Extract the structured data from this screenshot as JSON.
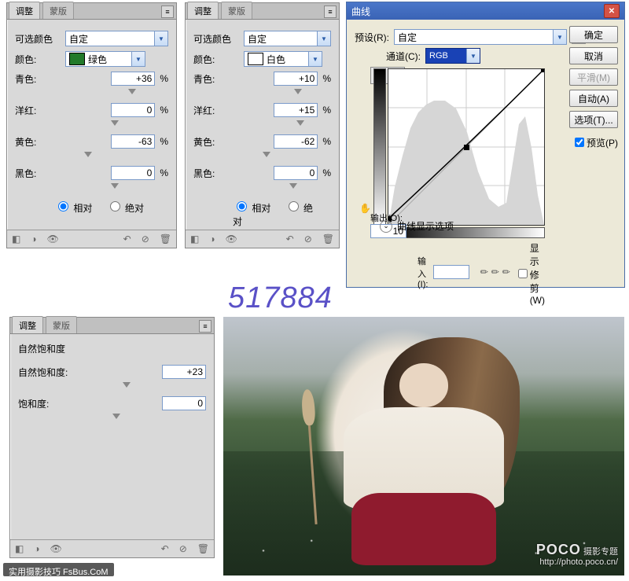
{
  "tabs": {
    "adjust": "调整",
    "mask": "蒙版"
  },
  "selcolor": {
    "title": "可选颜色",
    "custom": "自定",
    "green": {
      "swatch": "#227a2a",
      "label": "绿色"
    },
    "white": {
      "swatch": "#ffffff",
      "label": "白色"
    },
    "colorLabel": "颜色:",
    "cyan": "青色:",
    "magenta": "洋红:",
    "yellow": "黄色:",
    "black": "黑色:",
    "p1": {
      "c": "+36",
      "m": "0",
      "y": "-63",
      "k": "0"
    },
    "p2": {
      "c": "+10",
      "m": "+15",
      "y": "-62",
      "k": "0"
    },
    "relative": "相对",
    "absolute": "绝对",
    "pct": "%"
  },
  "curves": {
    "title": "曲线",
    "presetLabel": "预设(R):",
    "preset": "自定",
    "channelLabel": "通道(C):",
    "channel": "RGB",
    "outputLabel": "输出(O):",
    "output": "10",
    "inputLabel": "输入(I):",
    "showClip": "显示修剪(W)",
    "disp": "曲线显示选项",
    "buttons": {
      "ok": "确定",
      "cancel": "取消",
      "smooth": "平滑(M)",
      "auto": "自动(A)",
      "options": "选项(T)...",
      "preview": "预览(P)"
    }
  },
  "vibrance": {
    "title": "自然饱和度",
    "vibLabel": "自然饱和度:",
    "vib": "+23",
    "satLabel": "饱和度:",
    "sat": "0"
  },
  "watermark_number": "517884",
  "photo": {
    "poco_brand": "POCO",
    "poco_sub": "摄影专题",
    "poco_url": "http://photo.poco.cn/",
    "corner": "实用摄影技巧 FsBus.CoM"
  }
}
